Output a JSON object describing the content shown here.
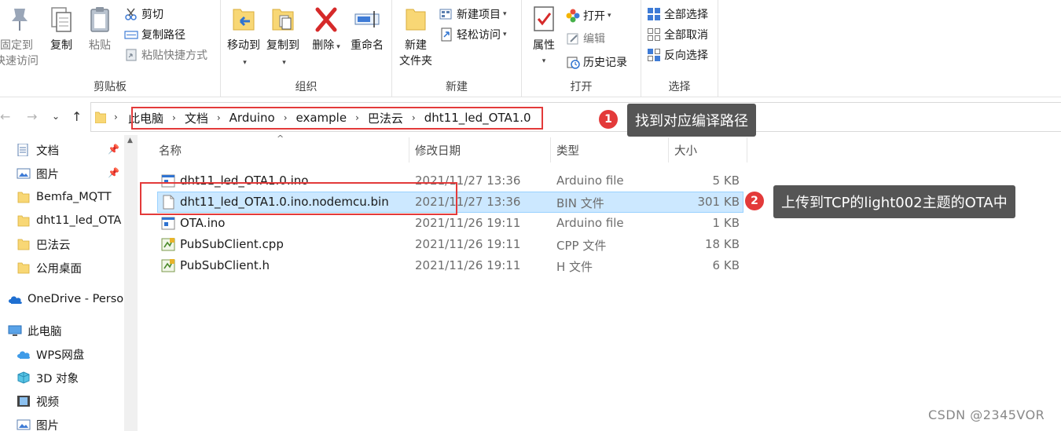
{
  "ribbon": {
    "clipboard": {
      "label": "剪贴板",
      "pin_label_1": "固定到",
      "pin_label_2": "快速访问",
      "copy": "复制",
      "paste": "粘贴",
      "cut": "剪切",
      "copy_path": "复制路径",
      "paste_shortcut": "粘贴快捷方式"
    },
    "organize": {
      "label": "组织",
      "move_to": "移动到",
      "copy_to": "复制到",
      "delete": "删除",
      "rename": "重命名"
    },
    "new": {
      "label": "新建",
      "new_folder_1": "新建",
      "new_folder_2": "文件夹",
      "new_item": "新建项目",
      "easy_access": "轻松访问"
    },
    "open": {
      "label": "打开",
      "properties": "属性",
      "open": "打开",
      "edit": "编辑",
      "history": "历史记录"
    },
    "select": {
      "label": "选择",
      "select_all": "全部选择",
      "select_none": "全部取消",
      "invert": "反向选择"
    }
  },
  "breadcrumb": [
    "此电脑",
    "文档",
    "Arduino",
    "example",
    "巴法云",
    "dht11_led_OTA1.0"
  ],
  "sidebar": {
    "items": [
      {
        "label": "文档",
        "icon": "documents-icon",
        "pinned": true
      },
      {
        "label": "图片",
        "icon": "pictures-icon",
        "pinned": true
      },
      {
        "label": "Bemfa_MQTT",
        "icon": "folder-icon",
        "pinned": false
      },
      {
        "label": "dht11_led_OTA",
        "icon": "folder-icon",
        "pinned": false
      },
      {
        "label": "巴法云",
        "icon": "folder-icon",
        "pinned": false
      },
      {
        "label": "公用桌面",
        "icon": "folder-icon",
        "pinned": false
      },
      {
        "label": "OneDrive - Perso",
        "icon": "onedrive-icon",
        "pinned": false
      },
      {
        "label": "此电脑",
        "icon": "this-pc-icon",
        "pinned": false
      },
      {
        "label": "WPS网盘",
        "icon": "wps-cloud-icon",
        "pinned": false
      },
      {
        "label": "3D 对象",
        "icon": "3d-objects-icon",
        "pinned": false
      },
      {
        "label": "视频",
        "icon": "videos-icon",
        "pinned": false
      },
      {
        "label": "图片",
        "icon": "pictures-icon",
        "pinned": false
      }
    ]
  },
  "columns": {
    "name": "名称",
    "date": "修改日期",
    "type": "类型",
    "size": "大小"
  },
  "files": [
    {
      "name": "dht11_led_OTA1.0.ino",
      "date": "2021/11/27 13:36",
      "type": "Arduino file",
      "size": "5 KB",
      "icon": "arduino-file-icon",
      "selected": false
    },
    {
      "name": "dht11_led_OTA1.0.ino.nodemcu.bin",
      "date": "2021/11/27 13:36",
      "type": "BIN 文件",
      "size": "301 KB",
      "icon": "bin-file-icon",
      "selected": true
    },
    {
      "name": "OTA.ino",
      "date": "2021/11/26 19:11",
      "type": "Arduino file",
      "size": "1 KB",
      "icon": "arduino-file-icon",
      "selected": false
    },
    {
      "name": "PubSubClient.cpp",
      "date": "2021/11/26 19:11",
      "type": "CPP 文件",
      "size": "18 KB",
      "icon": "cpp-file-icon",
      "selected": false
    },
    {
      "name": "PubSubClient.h",
      "date": "2021/11/26 19:11",
      "type": "H 文件",
      "size": "6 KB",
      "icon": "h-file-icon",
      "selected": false
    }
  ],
  "annotations": [
    {
      "number": "1",
      "text": "找到对应编译路径"
    },
    {
      "number": "2",
      "text": "上传到TCP的light002主题的OTA中"
    }
  ],
  "watermark": "CSDN @2345VOR",
  "colors": {
    "highlight_red": "#e33a3a",
    "callout_bg": "#555555",
    "selection_bg": "#cce8ff",
    "selection_border": "#99d1ff",
    "folder_yellow": "#f8d775"
  }
}
